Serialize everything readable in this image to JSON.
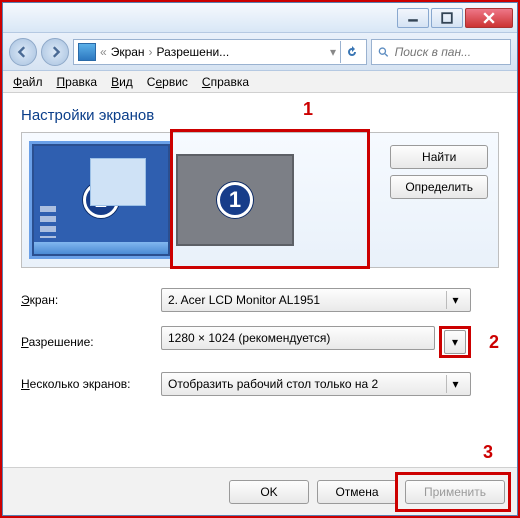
{
  "titlebar": {
    "minimize": "–",
    "maximize": "□",
    "close": "×"
  },
  "nav": {
    "breadcrumb_root": "Экран",
    "breadcrumb_sub": "Разрешени...",
    "search_placeholder": "Поиск в пан..."
  },
  "menubar": {
    "file": "Файл",
    "edit": "Правка",
    "view": "Вид",
    "tools": "Сервис",
    "help": "Справка"
  },
  "heading": "Настройки экранов",
  "annotations": {
    "a1": "1",
    "a2": "2",
    "a3": "3"
  },
  "monitors": {
    "mon1_num": "1",
    "mon2_num": "2"
  },
  "buttons": {
    "find": "Найти",
    "identify": "Определить",
    "ok": "OK",
    "cancel": "Отмена",
    "apply": "Применить"
  },
  "form": {
    "screen_label": "Экран:",
    "screen_value": "2. Acer LCD Monitor AL1951",
    "resolution_label": "Разрешение:",
    "resolution_value": "1280 × 1024 (рекомендуется)",
    "multi_label": "Несколько экранов:",
    "multi_value": "Отобразить рабочий стол только на 2"
  }
}
